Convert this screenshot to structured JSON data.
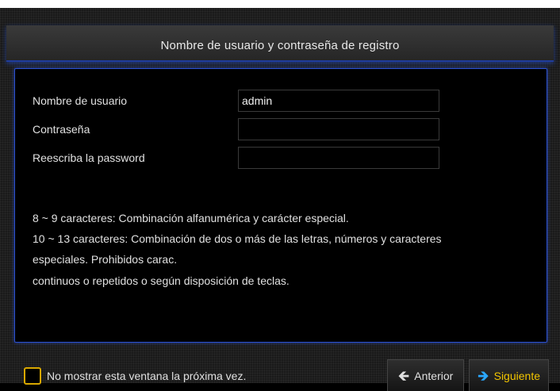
{
  "window": {
    "title": "Nombre de usuario y contraseña de registro"
  },
  "form": {
    "username_label": "Nombre de usuario",
    "username_value": "admin",
    "password_label": "Contraseña",
    "password_value": "",
    "confirm_label": "Reescriba la password",
    "confirm_value": ""
  },
  "hints": [
    "8 ~ 9 caracteres: Combinación alfanumérica y carácter especial.",
    "10 ~ 13 caracteres: Combinación de dos o más de las letras, números y caracteres",
    "especiales. Prohibidos carac.",
    "continuos o repetidos o según disposición de teclas."
  ],
  "footer": {
    "checkbox_label": "No mostrar esta ventana la próxima vez.",
    "checkbox_checked": false,
    "prev_label": "Anterior",
    "next_label": "Siguiente",
    "prev_icon": "arrow-left-icon",
    "next_icon": "arrow-right-icon"
  },
  "colors": {
    "accent_blue": "#2a4fd0",
    "highlight_yellow": "#f2c500",
    "arrow_blue": "#2aa8ff"
  }
}
